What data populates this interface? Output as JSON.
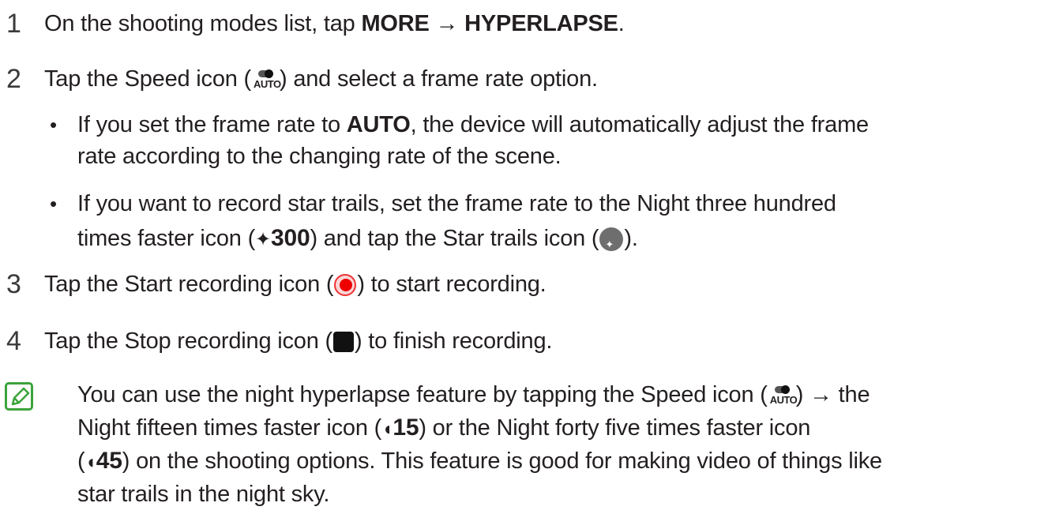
{
  "steps": [
    {
      "number": "1",
      "t1": "On the shooting modes list, tap ",
      "b1": "MORE",
      "t2": " → ",
      "b2": "HYPERLAPSE",
      "t3": "."
    },
    {
      "number": "2",
      "t1": "Tap the Speed icon (",
      "t2": ") and select a frame rate option."
    },
    {
      "number": "3",
      "t1": "Tap the Start recording icon (",
      "t2": ") to start recording."
    },
    {
      "number": "4",
      "t1": "Tap the Stop recording icon (",
      "t2": ") to finish recording."
    }
  ],
  "speed_icon_text": "AUTO",
  "bullets": [
    {
      "symbol": "•",
      "line1_pre": "If you set the frame rate to ",
      "line1_bold": "AUTO",
      "line1_post": ", the device will automatically adjust the frame",
      "line2": "rate according to the changing rate of the scene."
    },
    {
      "symbol": "•",
      "line1": "If you want to record star trails, set the frame rate to the Night three hundred",
      "line2_pre": "times faster icon (",
      "night300": "300",
      "line2_mid": ") and tap the Star trails icon (",
      "line2_post": ")."
    }
  ],
  "note": {
    "l1_pre": "You can use the night hyperlapse feature by tapping the Speed icon (",
    "l1_post": ") → the",
    "l2_pre": "Night fifteen times faster icon (",
    "n15": "15",
    "l2_mid": ") or the Night forty five times faster icon",
    "l3_pre": "(",
    "n45": "45",
    "l3_post": ") on the shooting options. This feature is good for making video of things like",
    "l4": "star trails in the night sky."
  }
}
